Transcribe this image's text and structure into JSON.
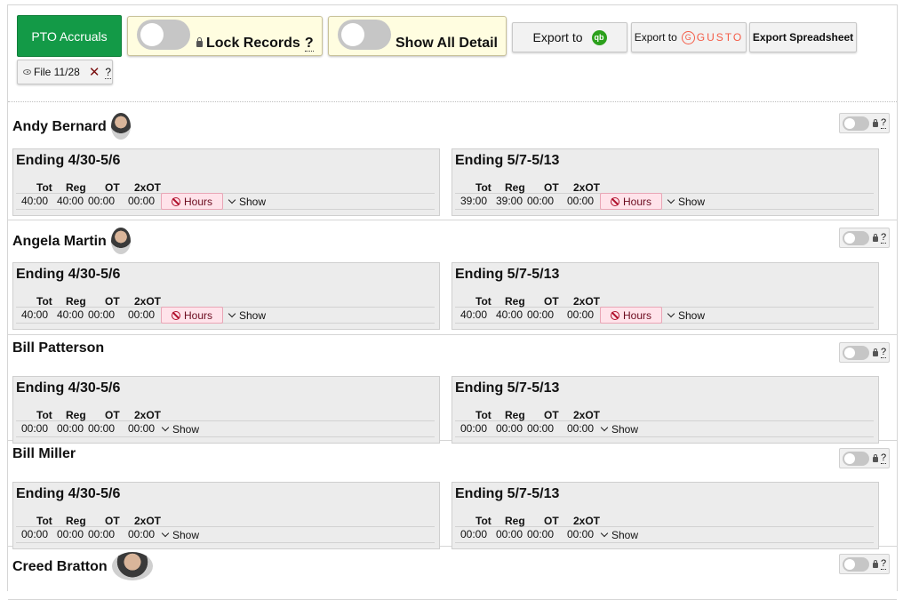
{
  "toolbar": {
    "pto_label": "PTO Accruals",
    "lock_label": "Lock Records",
    "lock_help": "?",
    "show_detail_label": "Show All Detail",
    "export_qb_label": "Export to",
    "export_qb_icon": "qb",
    "export_gusto_label": "Export to",
    "gusto_brand": "GUSTO",
    "export_spreadsheet_label": "Export Spreadsheet",
    "file_label": "File 11/28",
    "file_close": "✕",
    "file_help": "?"
  },
  "colors": {
    "pto": "#139a47",
    "hours_bg": "#ffe3ea",
    "toggle_bg": "#fffde0",
    "gusto": "#f45d48",
    "qb": "#2ca01c"
  },
  "columns": {
    "tot": "Tot",
    "reg": "Reg",
    "ot": "OT",
    "ot2": "2xOT"
  },
  "labels": {
    "hours": "Hours",
    "show": "Show",
    "help": "?"
  },
  "employees": [
    {
      "name": "Andy Bernard",
      "periods": [
        {
          "title": "Ending 4/30-5/6",
          "tot": "40:00",
          "reg": "40:00",
          "ot": "00:00",
          "ot2": "00:00",
          "hours_flag": true
        },
        {
          "title": "Ending 5/7-5/13",
          "tot": "39:00",
          "reg": "39:00",
          "ot": "00:00",
          "ot2": "00:00",
          "hours_flag": true
        }
      ]
    },
    {
      "name": "Angela Martin",
      "periods": [
        {
          "title": "Ending 4/30-5/6",
          "tot": "40:00",
          "reg": "40:00",
          "ot": "00:00",
          "ot2": "00:00",
          "hours_flag": true
        },
        {
          "title": "Ending 5/7-5/13",
          "tot": "40:00",
          "reg": "40:00",
          "ot": "00:00",
          "ot2": "00:00",
          "hours_flag": true
        }
      ]
    },
    {
      "name": "Bill Patterson",
      "periods": [
        {
          "title": "Ending 4/30-5/6",
          "tot": "00:00",
          "reg": "00:00",
          "ot": "00:00",
          "ot2": "00:00",
          "hours_flag": false
        },
        {
          "title": "Ending 5/7-5/13",
          "tot": "00:00",
          "reg": "00:00",
          "ot": "00:00",
          "ot2": "00:00",
          "hours_flag": false
        }
      ]
    },
    {
      "name": "Bill Miller",
      "periods": [
        {
          "title": "Ending 4/30-5/6",
          "tot": "00:00",
          "reg": "00:00",
          "ot": "00:00",
          "ot2": "00:00",
          "hours_flag": false
        },
        {
          "title": "Ending 5/7-5/13",
          "tot": "00:00",
          "reg": "00:00",
          "ot": "00:00",
          "ot2": "00:00",
          "hours_flag": false
        }
      ]
    },
    {
      "name": "Creed Bratton",
      "periods": []
    }
  ]
}
